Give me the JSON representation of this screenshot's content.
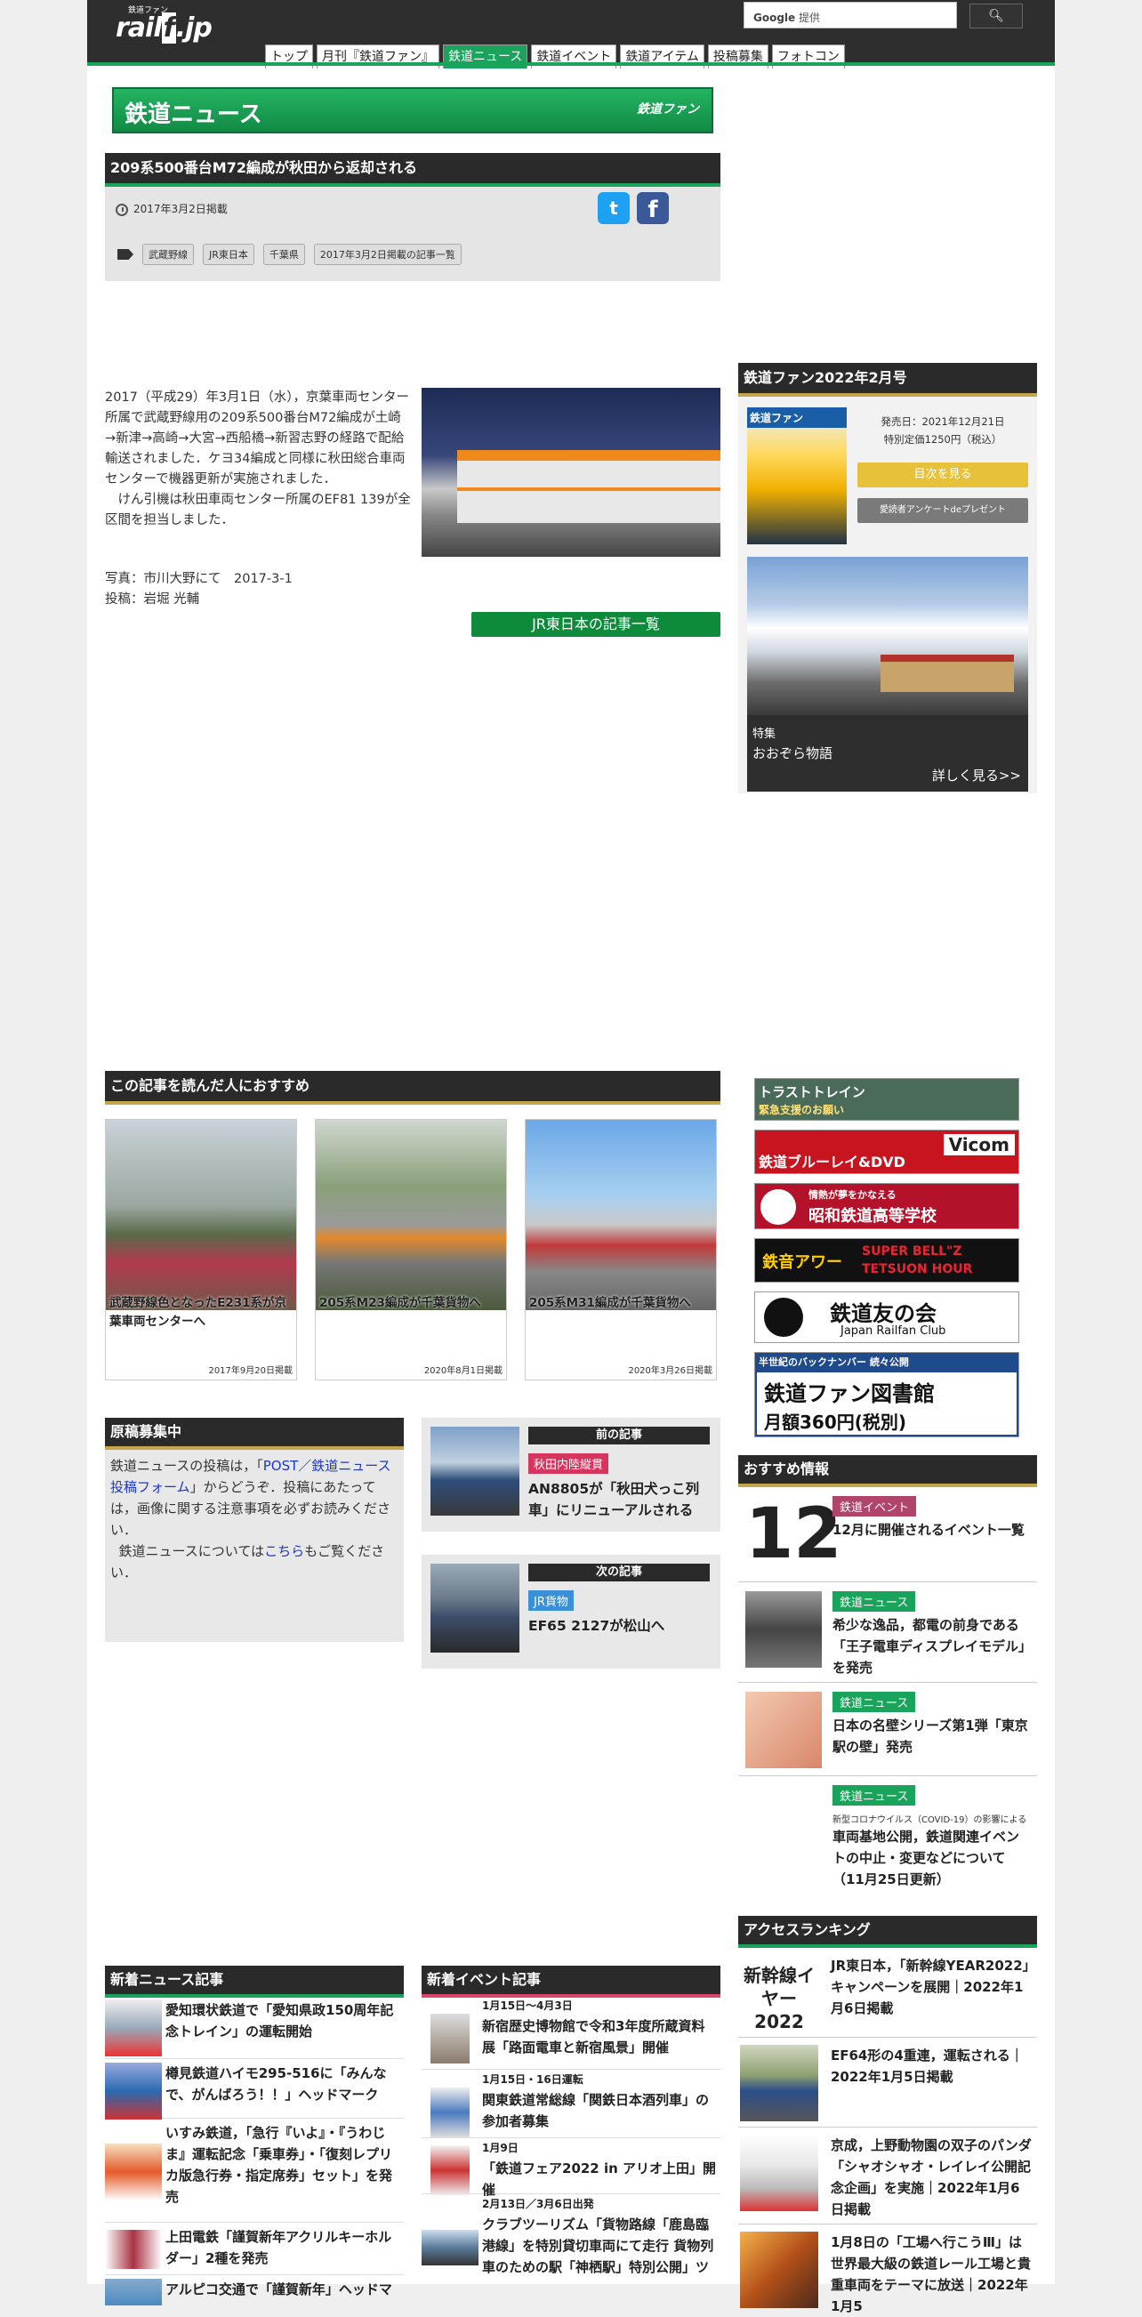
{
  "header": {
    "logo_small": "鉄道ファン",
    "logo_main_pre": "rail",
    "logo_main_box": "f",
    "logo_main_post": ".jp",
    "search_brand": "Google",
    "search_suffix": "提供",
    "nav": [
      "トップ",
      "月刊『鉄道ファン』",
      "鉄道ニュース",
      "鉄道イベント",
      "鉄道アイテム",
      "投稿募集",
      "フォトコン"
    ],
    "nav_active": 2
  },
  "banner": {
    "title": "鉄道ニュース",
    "brand": "鉄道ファン"
  },
  "article": {
    "title": "209系500番台M72編成が秋田から返却される",
    "date": "2017年3月2日掲載",
    "tags": [
      "武蔵野線",
      "JR東日本",
      "千葉県",
      "2017年3月2日掲載の記事一覧"
    ],
    "body_p1": "2017（平成29）年3月1日（水），京葉車両センター所属で武蔵野線用の209系500番台M72編成が土崎→新津→高崎→大宮→西船橋→新習志野の経路で配給輸送されました．ケヨ34編成と同様に秋田総合車両センターで機器更新が実施されました．",
    "body_p2": "けん引機は秋田車両センター所属のEF81 139が全区間を担当しました．",
    "photo_credit": "写真：市川大野にて　2017-3-1",
    "author": "投稿：岩堀 光輔",
    "list_button": "JR東日本の記事一覧"
  },
  "magazine": {
    "heading": "鉄道ファン2022年2月号",
    "cover_title": "鉄道ファン",
    "release": "発売日：2021年12月21日",
    "price": "特別定価1250円（税込）",
    "toc_button": "目次を見る",
    "survey_button": "愛読者アンケートdeプレゼント",
    "feature_label": "特集",
    "feature_title": "おおぞら物語",
    "feature_more": "詳しく見る>>"
  },
  "recommend": {
    "heading": "この記事を読んだ人におすすめ",
    "items": [
      {
        "title": "武蔵野線色となったE231系が京葉車両センターへ",
        "date": "2017年9月20日掲載"
      },
      {
        "title": "205系M23編成が千葉貨物へ",
        "date": "2020年8月1日掲載"
      },
      {
        "title": "205系M31編成が千葉貨物へ",
        "date": "2020年3月26日掲載"
      }
    ]
  },
  "ads": [
    {
      "main": "トラストトレイン",
      "sub": "緊急支援のお願い"
    },
    {
      "main": "鉄道ブルーレイ&DVD",
      "sub": "Vicom"
    },
    {
      "main": "昭和鉄道高等学校",
      "sub": "情熱が夢をかなえる"
    },
    {
      "main": "SUPER BELL\"Z TETSUON HOUR",
      "sub": "鉄音アワー"
    },
    {
      "main": "鉄道友の会",
      "sub": "Japan Railfan Club"
    },
    {
      "main": "鉄道ファン図書館",
      "sub": "月額360円(税別)"
    }
  ],
  "boshu": {
    "heading": "原稿募集中",
    "text_pre": "鉄道ニュースの投稿は，「",
    "link1": "POST／鉄道ニュース投稿フォーム",
    "text_mid": "」からどうぞ．投稿にあたっては，画像に関する注意事項を必ずお読みください．",
    "text_pre2": "鉄道ニュースについては",
    "link2": "こちら",
    "text_post2": "もご覧ください．"
  },
  "prev": {
    "label": "前の記事",
    "category": "秋田内陸縦貫",
    "title": "AN8805が「秋田犬っこ列車」にリニューアルされる"
  },
  "next": {
    "label": "次の記事",
    "category": "JR貨物",
    "title": "EF65 2127が松山へ"
  },
  "osusume": {
    "heading": "おすすめ情報",
    "items": [
      {
        "category": "鉄道イベント",
        "title": "12月に開催されるイベント一覧",
        "thumb_text": "12"
      },
      {
        "category": "鉄道ニュース",
        "title": "希少な逸品，都電の前身である「王子電車ディスプレイモデル」を発売"
      },
      {
        "category": "鉄道ニュース",
        "title": "日本の名壁シリーズ第1弾「東京駅の壁」発売"
      },
      {
        "category": "鉄道ニュース",
        "note": "新型コロナウイルス（COVID-19）の影響による",
        "title": "車両基地公開，鉄道関連イベントの中止・変更などについて（11月25日更新）"
      }
    ]
  },
  "ranking": {
    "heading": "アクセスランキング",
    "items": [
      {
        "title": "JR東日本，「新幹線YEAR2022」キャンペーンを展開｜2022年1月6日掲載",
        "thumb_text": "新幹線イヤー2022"
      },
      {
        "title": "EF64形の4重連，運転される｜2022年1月5日掲載"
      },
      {
        "title": "京成，上野動物園の双子のパンダ「シャオシャオ・レイレイ公開記念企画」を実施｜2022年1月6日掲載"
      },
      {
        "title": "1月8日の「工場へ行こうⅢ」は世界最大級の鉄道レール工場と貴重車両をテーマに放送｜2022年1月5"
      }
    ]
  },
  "newnews": {
    "heading": "新着ニュース記事",
    "items": [
      "愛知環状鉄道で「愛知県政150周年記念トレイン」の運転開始",
      "樽見鉄道ハイモ295-516に「みんなで、がんばろう！！」ヘッドマーク",
      "いすみ鉄道，「急行『いよ』・『うわじま』運転記念「乗車券」・「復刻レプリカ版急行券・指定席券」セット」を発売",
      "上田電鉄「謹賀新年アクリルキーホルダー」2種を発売",
      "アルピコ交通で「謹賀新年」ヘッドマ"
    ]
  },
  "newevents": {
    "heading": "新着イベント記事",
    "items": [
      {
        "date": "1月15日〜4月3日",
        "title": "新宿歴史博物館で令和3年度所蔵資料展「路面電車と新宿風景」開催"
      },
      {
        "date": "1月15日・16日運転",
        "title": "関東鉄道常総線「関鉄日本酒列車」の参加者募集"
      },
      {
        "date": "1月9日",
        "title": "「鉄道フェア2022 in アリオ上田」開催"
      },
      {
        "date": "2月13日／3月6日出発",
        "title": "クラブツーリズム「貨物路線「鹿島臨港線」を特別貸切車両にて走行 貨物列車のための駅「神栖駅」特別公開」ツ"
      }
    ]
  },
  "colors": {
    "brand_green": "#1aa35a",
    "dark": "#2a2a2a",
    "cat_red": "#d6355f",
    "cat_blue": "#3a8fd6",
    "cat_green": "#1aa35a",
    "cat_purple": "#b0446b"
  }
}
